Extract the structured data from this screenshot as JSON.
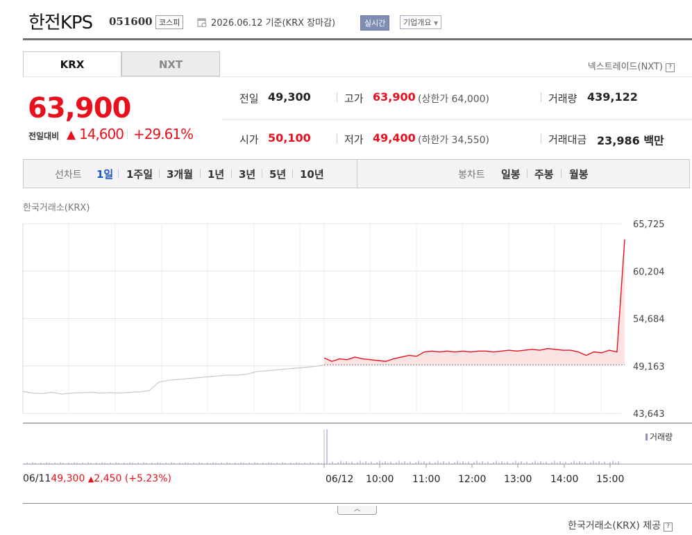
{
  "header": {
    "company": "한전KPS",
    "code": "051600",
    "market": "코스피",
    "date_text": "2026.06.12  기준(KRX 장마감)",
    "realtime": "실시간",
    "company_info": "기업개요",
    "calendar_icon": "calendar-icon",
    "dropdown_icon": "caret-down-icon"
  },
  "tabs": [
    {
      "label": "KRX",
      "active": true
    },
    {
      "label": "NXT",
      "active": false
    }
  ],
  "nxt_link": "넥스트레이드(NXT)",
  "help_icon": "?",
  "price": {
    "current": "63,900",
    "change_label": "전일대비",
    "arrow": "▲",
    "change": "14,600",
    "rate": "+29.61%"
  },
  "stats": {
    "prev_close_label": "전일",
    "prev_close": "49,300",
    "high_label": "고가",
    "high": "63,900",
    "upper_limit": "(상한가 64,000)",
    "volume_label": "거래량",
    "volume": "439,122",
    "open_label": "시가",
    "open": "50,100",
    "low_label": "저가",
    "low": "49,400",
    "lower_limit": "(하한가 34,550)",
    "amount_label": "거래대금",
    "amount": "23,986",
    "amount_unit": "백만"
  },
  "line_chart": {
    "label": "선차트",
    "periods": [
      "1일",
      "1주일",
      "3개월",
      "1년",
      "3년",
      "5년",
      "10년"
    ],
    "active": "1일"
  },
  "candle_chart": {
    "label": "봉차트",
    "periods": [
      "일봉",
      "주봉",
      "월봉"
    ]
  },
  "source_label": "한국거래소(KRX)",
  "volume_legend": "거래량",
  "prev_day": {
    "date": "06/11",
    "close": "49,300",
    "arrow": "▲",
    "change": "2,450",
    "rate": "(+5.23%)"
  },
  "provider": "한국거래소(KRX) 제공",
  "collapse_icon": "chevron-up-icon",
  "colors": {
    "up": "#e8101c",
    "area_fill": "#fbe3e3",
    "prev_line": "#c8c8c8",
    "volume": "#8c8cc8",
    "active_period": "#1a56c8"
  },
  "chart_data": {
    "type": "line",
    "y_ticks": [
      "65,725",
      "60,204",
      "54,684",
      "49,163",
      "43,643"
    ],
    "ylim": [
      43643,
      65725
    ],
    "x_ticks": [
      "06/12",
      "10:00",
      "11:00",
      "12:00",
      "13:00",
      "14:00",
      "15:00"
    ],
    "baseline": 49300,
    "series": [
      {
        "name": "",
        "note_values": "previous day trace (06/11)",
        "segment": "prev",
        "values": [
          46200,
          46000,
          45950,
          46100,
          45900,
          46000,
          46050,
          46100,
          46000,
          46050,
          46000,
          46100,
          46150,
          46300,
          47300,
          47500,
          47600,
          47700,
          47800,
          47900,
          48000,
          48100,
          48100,
          48200,
          48500,
          48600,
          48700,
          48800,
          48900,
          49000,
          49100,
          49300
        ]
      },
      {
        "name": "",
        "segment": "today",
        "x": [
          "09:00",
          "09:10",
          "09:20",
          "09:30",
          "09:40",
          "09:50",
          "10:00",
          "10:10",
          "10:20",
          "10:30",
          "10:40",
          "10:50",
          "11:00",
          "11:10",
          "11:20",
          "11:30",
          "11:40",
          "11:50",
          "12:00",
          "12:10",
          "12:20",
          "12:30",
          "12:40",
          "12:50",
          "13:00",
          "13:10",
          "13:20",
          "13:30",
          "13:40",
          "13:50",
          "14:00",
          "14:10",
          "14:20",
          "14:30",
          "14:40",
          "14:50",
          "15:00",
          "15:10",
          "15:18",
          "15:20"
        ],
        "values": [
          50100,
          49700,
          50000,
          49900,
          50200,
          50000,
          49900,
          49800,
          49700,
          50000,
          50200,
          50400,
          50300,
          50800,
          50900,
          50800,
          50900,
          50800,
          50900,
          50800,
          50900,
          50900,
          50800,
          50900,
          51000,
          50900,
          51000,
          51100,
          51000,
          51200,
          51100,
          51000,
          51000,
          50800,
          50400,
          50800,
          50700,
          51000,
          50800,
          63900
        ]
      }
    ]
  }
}
